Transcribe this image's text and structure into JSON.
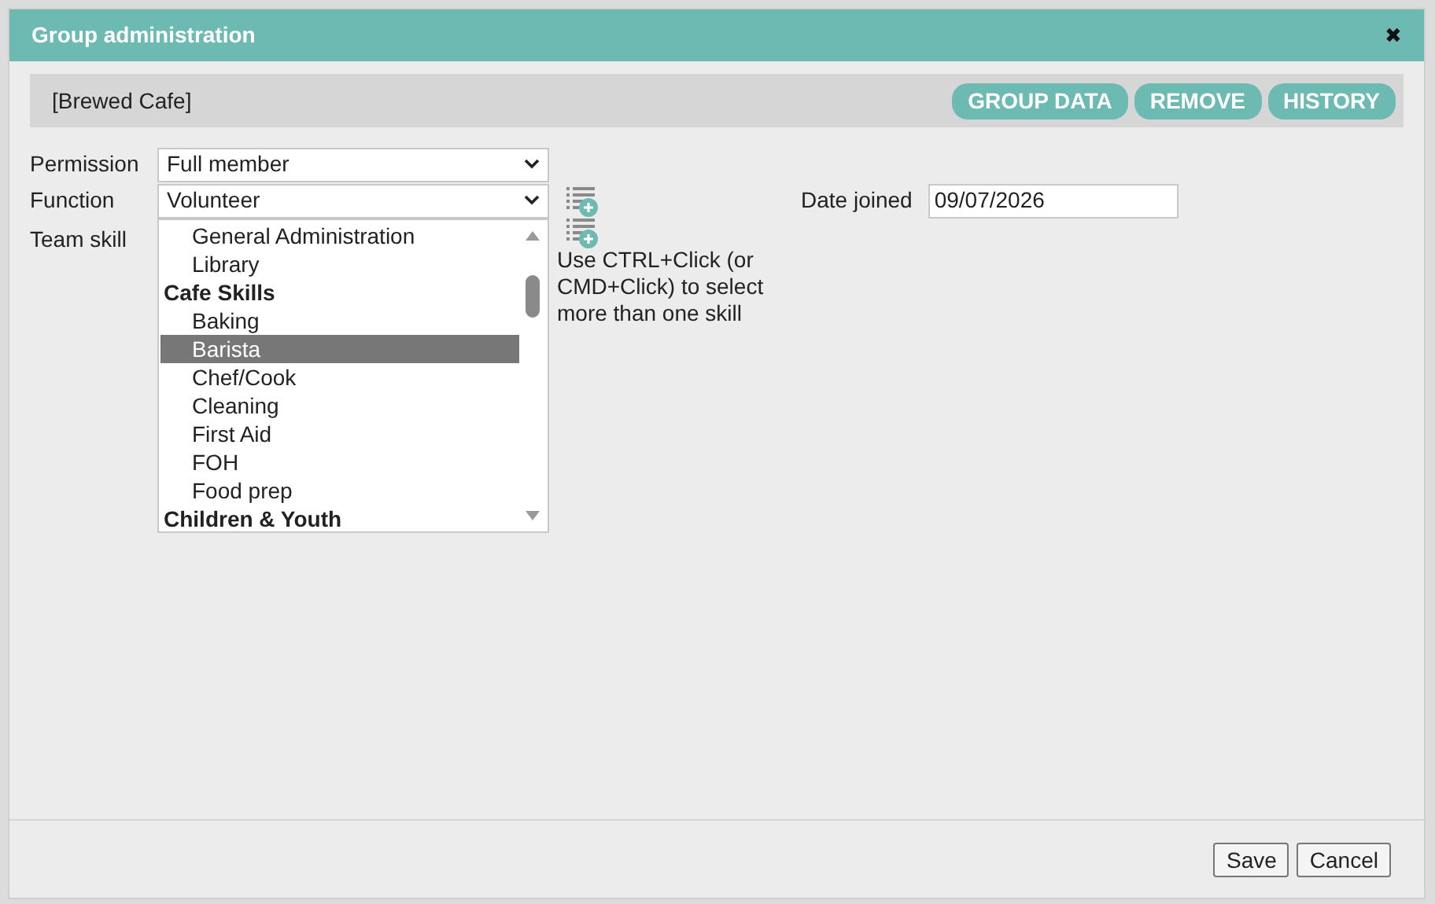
{
  "dialog": {
    "title": "Group administration",
    "close": "✖"
  },
  "header": {
    "group_name": "[Brewed Cafe]",
    "buttons": [
      "GROUP DATA",
      "REMOVE",
      "HISTORY"
    ]
  },
  "form": {
    "permission": {
      "label": "Permission",
      "value": "Full member"
    },
    "function": {
      "label": "Function",
      "value": "Volunteer"
    },
    "date_joined": {
      "label": "Date joined",
      "value": "09/07/2026"
    },
    "team_skill": {
      "label": "Team skill",
      "hint": "Use CTRL+Click (or CMD+Click) to select more than one skill",
      "options": [
        {
          "kind": "option",
          "label": "General Administration",
          "selected": false
        },
        {
          "kind": "option",
          "label": "Library",
          "selected": false
        },
        {
          "kind": "group",
          "label": "Cafe Skills",
          "selected": false
        },
        {
          "kind": "option",
          "label": "Baking",
          "selected": false
        },
        {
          "kind": "option",
          "label": "Barista",
          "selected": true
        },
        {
          "kind": "option",
          "label": "Chef/Cook",
          "selected": false
        },
        {
          "kind": "option",
          "label": "Cleaning",
          "selected": false
        },
        {
          "kind": "option",
          "label": "First Aid",
          "selected": false
        },
        {
          "kind": "option",
          "label": "FOH",
          "selected": false
        },
        {
          "kind": "option",
          "label": "Food prep",
          "selected": false
        },
        {
          "kind": "group",
          "label": "Children & Youth",
          "selected": false
        }
      ]
    }
  },
  "footer": {
    "buttons": [
      "Save",
      "Cancel"
    ]
  }
}
